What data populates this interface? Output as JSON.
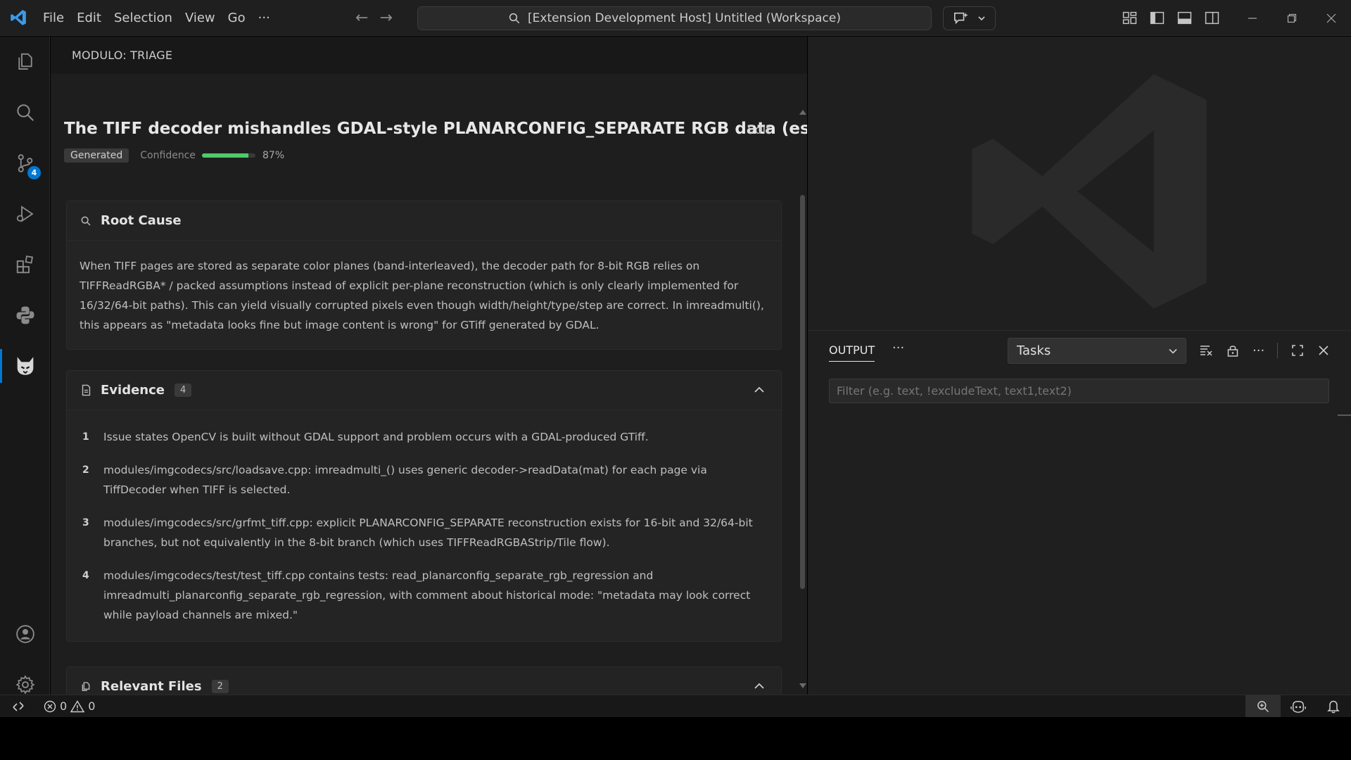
{
  "menu": [
    "File",
    "Edit",
    "Selection",
    "View",
    "Go",
    "···"
  ],
  "command_center": {
    "text": "[Extension Development Host] Untitled (Workspace)"
  },
  "activity_bar": {
    "scm_badge": "4"
  },
  "panel": {
    "header": "MODULO: TRIAGE",
    "title": "The TIFF decoder mishandles GDAL-style PLANARCONFIG_SEPARATE RGB data (es...",
    "edit_label": "Edit",
    "tag": "Generated",
    "confidence_label": "Confidence",
    "confidence_value": 0.87,
    "confidence_text": "87%"
  },
  "root_cause": {
    "title": "Root Cause",
    "text": "When TIFF pages are stored as separate color planes (band-interleaved), the decoder path for 8-bit RGB relies on TIFFReadRGBA* / packed assumptions instead of explicit per-plane reconstruction (which is only clearly implemented for 16/32/64-bit paths). This can yield visually corrupted pixels even though width/height/type/step are correct. In imreadmulti(), this appears as \"metadata looks fine but image content is wrong\" for GTiff generated by GDAL."
  },
  "evidence": {
    "title": "Evidence",
    "count": "4",
    "items": [
      {
        "num": "1",
        "text": "Issue states OpenCV is built without GDAL support and problem occurs with a GDAL-produced GTiff."
      },
      {
        "num": "2",
        "text": "modules/imgcodecs/src/loadsave.cpp: imreadmulti_() uses generic decoder->readData(mat) for each page via TiffDecoder when TIFF is selected."
      },
      {
        "num": "3",
        "text": "modules/imgcodecs/src/grfmt_tiff.cpp: explicit PLANARCONFIG_SEPARATE reconstruction exists for 16-bit and 32/64-bit branches, but not equivalently in the 8-bit branch (which uses TIFFReadRGBAStrip/Tile flow)."
      },
      {
        "num": "4",
        "text": "modules/imgcodecs/test/test_tiff.cpp contains tests: read_planarconfig_separate_rgb_regression and imreadmulti_planarconfig_separate_rgb_regression, with comment about historical mode: \"metadata may look correct while payload channels are mixed.\""
      }
    ]
  },
  "relevant_files": {
    "title": "Relevant Files",
    "count": "2"
  },
  "output": {
    "tab": "OUTPUT",
    "more": "···",
    "select_value": "Tasks",
    "filter_placeholder": "Filter (e.g. text, !excludeText, text1,text2)"
  },
  "status": {
    "errors": "0",
    "warnings": "0"
  },
  "colors": {
    "accent": "#0078d4",
    "confidence": "#4ec96b"
  }
}
